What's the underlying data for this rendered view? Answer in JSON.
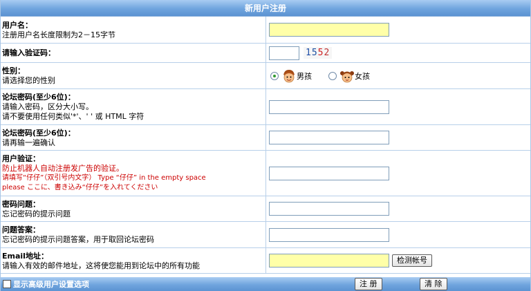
{
  "header": {
    "title": "新用户注册"
  },
  "username": {
    "title": "用户名：",
    "desc": "注册用户名长度限制为2－15字节",
    "value": ""
  },
  "captcha": {
    "title": "请输入验证码：",
    "value": "",
    "code": [
      "1",
      "5",
      "5",
      "2"
    ]
  },
  "gender": {
    "title": "性别：",
    "desc": "请选择您的性别",
    "male_label": "男孩",
    "female_label": "女孩",
    "selected": "male"
  },
  "password": {
    "title": "论坛密码(至少6位)：",
    "desc1": "请输入密码，区分大小写。",
    "desc2": "请不要使用任何类似'*'、' ' 或 HTML 字符",
    "value": ""
  },
  "password_confirm": {
    "title": "论坛密码(至少6位)：",
    "desc": "请再输一遍确认",
    "value": ""
  },
  "verify": {
    "title": "用户验证：",
    "line1": "防止机器人自动注册发广告的验证。",
    "line2": "请填写“仔仔”（双引号内文字） Type “仔仔” in the empty space",
    "line3": "please ここに、書き込み“仔仔”を入れてください",
    "value": ""
  },
  "question": {
    "title": "密码问题：",
    "desc": "忘记密码的提示问题",
    "value": ""
  },
  "answer": {
    "title": "问题答案：",
    "desc": "忘记密码的提示问题答案，用于取回论坛密码",
    "value": ""
  },
  "email": {
    "title": "Email地址：",
    "desc": "请输入有效的邮件地址，这将使您能用到论坛中的所有功能",
    "value": "",
    "check_button": "检测帐号"
  },
  "footer": {
    "advanced_label": "显示高级用户设置选项",
    "advanced_checked": false,
    "submit_label": "注 册",
    "reset_label": "清 除"
  },
  "colors": {
    "header_blue": "#6fa4de",
    "input_yellow": "#ffffa8",
    "warning_red": "#cc0000"
  }
}
